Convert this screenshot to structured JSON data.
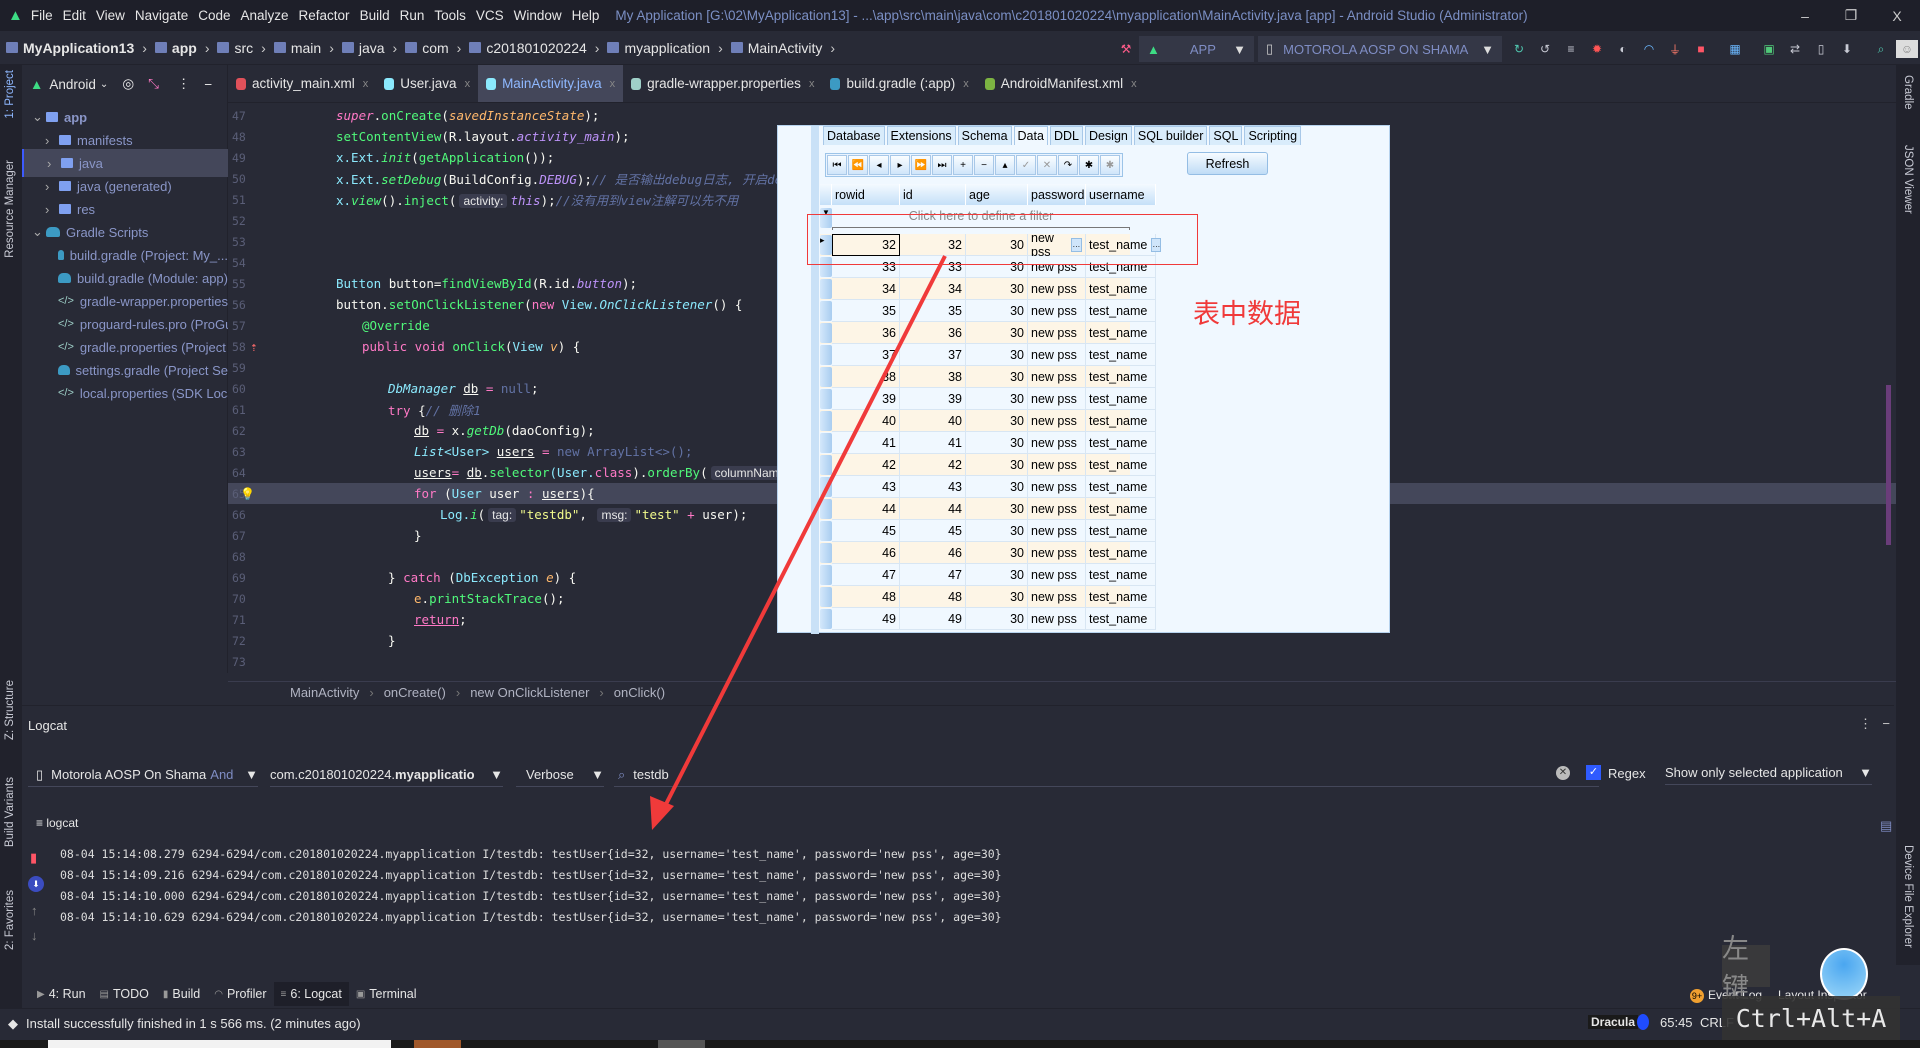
{
  "window": {
    "title": "My Application [G:\\02\\MyApplication13] - ...\\app\\src\\main\\java\\com\\c201801020224\\myapplication\\MainActivity.java [app] - Android Studio (Administrator)",
    "minimize": "–",
    "maximize": "❐",
    "close": "X"
  },
  "menu": [
    "File",
    "Edit",
    "View",
    "Navigate",
    "Code",
    "Analyze",
    "Refactor",
    "Build",
    "Run",
    "Tools",
    "VCS",
    "Window",
    "Help"
  ],
  "breadcrumb": [
    "MyApplication13",
    "app",
    "src",
    "main",
    "java",
    "com",
    "c201801020224",
    "myapplication",
    "MainActivity"
  ],
  "run_config": {
    "module": "APP",
    "device": "MOTOROLA AOSP ON SHAMA"
  },
  "left_strip": {
    "project": "1: Project",
    "resource_manager": "Resource Manager",
    "structure": "Z: Structure",
    "build_variants": "Build Variants",
    "favorites": "2: Favorites"
  },
  "right_strip": {
    "gradle": "Gradle",
    "json_viewer": "JSON Viewer",
    "device_file_explorer": "Device File Explorer"
  },
  "project": {
    "view": "Android",
    "tree": [
      {
        "label": "app",
        "depth": 0,
        "icon": "folder"
      },
      {
        "label": "manifests",
        "depth": 1,
        "icon": "folder"
      },
      {
        "label": "java",
        "depth": 1,
        "icon": "folder",
        "selected": true
      },
      {
        "label": "java (generated)",
        "depth": 1,
        "icon": "folder"
      },
      {
        "label": "res",
        "depth": 1,
        "icon": "folder"
      },
      {
        "label": "Gradle Scripts",
        "depth": 0,
        "icon": "gradle"
      },
      {
        "label": "build.gradle (Project: My_...",
        "depth": 2,
        "icon": "gradle"
      },
      {
        "label": "build.gradle (Module: app)",
        "depth": 2,
        "icon": "gradle"
      },
      {
        "label": "gradle-wrapper.properties",
        "depth": 2,
        "icon": "properties"
      },
      {
        "label": "proguard-rules.pro (ProGuard",
        "depth": 2,
        "icon": "proguard"
      },
      {
        "label": "gradle.properties (Project",
        "depth": 2,
        "icon": "properties"
      },
      {
        "label": "settings.gradle (Project Se",
        "depth": 2,
        "icon": "gradle"
      },
      {
        "label": "local.properties (SDK Loca",
        "depth": 2,
        "icon": "properties"
      }
    ]
  },
  "tabs": [
    {
      "label": "activity_main.xml",
      "color": "#e0515a"
    },
    {
      "label": "User.java",
      "color": "#8be9fd"
    },
    {
      "label": "MainActivity.java",
      "color": "#8be9fd",
      "active": true
    },
    {
      "label": "gradle-wrapper.properties",
      "color": "#9fd0c8"
    },
    {
      "label": "build.gradle (:app)",
      "color": "#3c9ac3"
    },
    {
      "label": "AndroidManifest.xml",
      "color": "#7cb342"
    }
  ],
  "code": [
    {
      "n": "47",
      "ind": 0,
      "t": [
        [
          "super",
          "k i"
        ],
        [
          ".",
          "pl"
        ],
        [
          "onCreate",
          "f"
        ],
        [
          "(",
          "pl"
        ],
        [
          "savedInstanceState",
          "o i"
        ],
        [
          ");",
          "pl"
        ]
      ]
    },
    {
      "n": "48",
      "ind": 0,
      "t": [
        [
          "setContentView",
          "f"
        ],
        [
          "(R.layout.",
          "pl"
        ],
        [
          "activity_main",
          "p i"
        ],
        [
          ");",
          "pl"
        ]
      ]
    },
    {
      "n": "49",
      "ind": 0,
      "t": [
        [
          "x.Ext.",
          "t"
        ],
        [
          "init",
          "f i"
        ],
        [
          "(",
          "pl"
        ],
        [
          "getApplication",
          "f"
        ],
        [
          "());",
          "pl"
        ]
      ]
    },
    {
      "n": "50",
      "ind": 0,
      "t": [
        [
          "x.Ext.",
          "t"
        ],
        [
          "setDebug",
          "f i"
        ],
        [
          "(BuildConfig.",
          "pl"
        ],
        [
          "DEBUG",
          "p i"
        ],
        [
          ");",
          "pl"
        ],
        [
          "// 是否输出debug日志, 开启debug",
          "c"
        ]
      ]
    },
    {
      "n": "51",
      "ind": 0,
      "t": [
        [
          "x.",
          "t"
        ],
        [
          "view",
          "f i"
        ],
        [
          "().",
          "pl"
        ],
        [
          "inject",
          "f"
        ],
        [
          "(",
          "pl"
        ],
        [
          "activity:",
          "hint"
        ],
        [
          "this",
          "p i"
        ],
        [
          ");",
          "pl"
        ],
        [
          "//没有用到view注解可以先不用",
          "c"
        ]
      ]
    },
    {
      "n": "52",
      "ind": 0,
      "t": []
    },
    {
      "n": "53",
      "ind": 0,
      "t": []
    },
    {
      "n": "54",
      "ind": 0,
      "t": []
    },
    {
      "n": "55",
      "ind": 0,
      "t": [
        [
          "Button ",
          "t"
        ],
        [
          "button=",
          "pl"
        ],
        [
          "findViewById",
          "f"
        ],
        [
          "(R.id.",
          "pl"
        ],
        [
          "button",
          "p i"
        ],
        [
          ");",
          "pl"
        ]
      ]
    },
    {
      "n": "56",
      "ind": 0,
      "t": [
        [
          "button.",
          "pl"
        ],
        [
          "setOnClickListener",
          "f"
        ],
        [
          "(",
          "pl"
        ],
        [
          "new ",
          "k"
        ],
        [
          "View.",
          "t"
        ],
        [
          "OnClickListener",
          "t i"
        ],
        [
          "() {",
          "pl"
        ]
      ]
    },
    {
      "n": "57",
      "ind": 1,
      "t": [
        [
          "@Override",
          "f"
        ]
      ]
    },
    {
      "n": "58",
      "ind": 1,
      "t": [
        [
          "public void ",
          "k"
        ],
        [
          "onClick",
          "f"
        ],
        [
          "(",
          "pl"
        ],
        [
          "View ",
          "t"
        ],
        [
          "v",
          "o i"
        ],
        [
          ") {",
          "pl"
        ]
      ]
    },
    {
      "n": "59",
      "ind": 0,
      "t": []
    },
    {
      "n": "60",
      "ind": 2,
      "t": [
        [
          "DbManager ",
          "t i"
        ],
        [
          "db",
          "pl u"
        ],
        [
          " = ",
          "k"
        ],
        [
          "null",
          "g"
        ],
        [
          ";",
          "pl"
        ]
      ]
    },
    {
      "n": "61",
      "ind": 2,
      "t": [
        [
          "try ",
          "k"
        ],
        [
          "{",
          "pl"
        ],
        [
          "// 删除1",
          "c"
        ]
      ]
    },
    {
      "n": "62",
      "ind": 3,
      "t": [
        [
          "db",
          "pl u"
        ],
        [
          " = ",
          "k"
        ],
        [
          "x.",
          "pl"
        ],
        [
          "getDb",
          "f i"
        ],
        [
          "(daoConfig);",
          "pl"
        ]
      ]
    },
    {
      "n": "63",
      "ind": 3,
      "t": [
        [
          "List",
          "t i"
        ],
        [
          "<User> ",
          "t"
        ],
        [
          "users",
          "pl u"
        ],
        [
          " = ",
          "k"
        ],
        [
          "new ArrayList<>();",
          "g"
        ]
      ]
    },
    {
      "n": "64",
      "ind": 3,
      "t": [
        [
          "users",
          "pl u"
        ],
        [
          "= ",
          "k"
        ],
        [
          "db",
          "pl u"
        ],
        [
          ".",
          "pl"
        ],
        [
          "selector",
          "f"
        ],
        [
          "(User.",
          "t"
        ],
        [
          "class",
          "k"
        ],
        [
          ").",
          "pl"
        ],
        [
          "orderBy",
          "f"
        ],
        [
          "(",
          "pl"
        ],
        [
          "columnName",
          "hint"
        ]
      ]
    },
    {
      "n": "65",
      "ind": 3,
      "cur": true,
      "t": [
        [
          "for ",
          "k"
        ],
        [
          "(",
          "pl"
        ],
        [
          "User ",
          "t"
        ],
        [
          "user ",
          "pl"
        ],
        [
          ": ",
          "k"
        ],
        [
          "users",
          "pl u"
        ],
        [
          "){",
          "pl"
        ]
      ]
    },
    {
      "n": "66",
      "ind": 4,
      "t": [
        [
          "Log.",
          "t"
        ],
        [
          "i",
          "f i"
        ],
        [
          "(",
          "pl"
        ],
        [
          "tag:",
          "hint"
        ],
        [
          "\"testdb\"",
          "s"
        ],
        [
          ", ",
          "pl"
        ],
        [
          "msg:",
          "hint"
        ],
        [
          "\"test\"",
          "s"
        ],
        [
          " + ",
          "k"
        ],
        [
          "user);",
          "pl"
        ]
      ]
    },
    {
      "n": "67",
      "ind": 3,
      "t": [
        [
          "}",
          "pl"
        ]
      ]
    },
    {
      "n": "68",
      "ind": 0,
      "t": []
    },
    {
      "n": "69",
      "ind": 2,
      "t": [
        [
          "} ",
          "pl"
        ],
        [
          "catch ",
          "k"
        ],
        [
          "(",
          "pl"
        ],
        [
          "DbException ",
          "t"
        ],
        [
          "e",
          "o i"
        ],
        [
          ") {",
          "pl"
        ]
      ]
    },
    {
      "n": "70",
      "ind": 3,
      "t": [
        [
          "e",
          "o"
        ],
        [
          ".",
          "pl"
        ],
        [
          "printStackTrace",
          "f"
        ],
        [
          "();",
          "pl"
        ]
      ]
    },
    {
      "n": "71",
      "ind": 3,
      "t": [
        [
          "return",
          "k u"
        ],
        [
          ";",
          "pl"
        ]
      ]
    },
    {
      "n": "72",
      "ind": 2,
      "t": [
        [
          "}",
          "pl"
        ]
      ]
    },
    {
      "n": "73",
      "ind": 0,
      "t": []
    }
  ],
  "editor_breadcrumb": [
    "MainActivity",
    "onCreate()",
    "new OnClickListener",
    "onClick()"
  ],
  "db_tool": {
    "tabs": [
      "Database",
      "Extensions",
      "Schema",
      "Data",
      "DDL",
      "Design",
      "SQL builder",
      "SQL",
      "Scripting"
    ],
    "active_tab": "Data",
    "nav_buttons": [
      "first",
      "prior-page",
      "prior",
      "next",
      "next-page",
      "last",
      "insert",
      "delete",
      "edit",
      "post",
      "cancel",
      "refresh-row",
      "bookmark",
      "clear-bookmark"
    ],
    "nav_glyphs": [
      "⏮",
      "⏪",
      "◂",
      "▸",
      "⏩",
      "⏭",
      "+",
      "−",
      "▴",
      "✓",
      "✕",
      "↷",
      "✱",
      "✱"
    ],
    "refresh": "Refresh",
    "filter_hint": "Click here to define a filter",
    "columns": [
      "rowid",
      "id",
      "age",
      "password",
      "username"
    ],
    "rows": [
      [
        32,
        32,
        30,
        "new pss",
        "test_name"
      ],
      [
        33,
        33,
        30,
        "new pss",
        "test_name"
      ],
      [
        34,
        34,
        30,
        "new pss",
        "test_name"
      ],
      [
        35,
        35,
        30,
        "new pss",
        "test_name"
      ],
      [
        36,
        36,
        30,
        "new pss",
        "test_name"
      ],
      [
        37,
        37,
        30,
        "new pss",
        "test_name"
      ],
      [
        38,
        38,
        30,
        "new pss",
        "test_name"
      ],
      [
        39,
        39,
        30,
        "new pss",
        "test_name"
      ],
      [
        40,
        40,
        30,
        "new pss",
        "test_name"
      ],
      [
        41,
        41,
        30,
        "new pss",
        "test_name"
      ],
      [
        42,
        42,
        30,
        "new pss",
        "test_name"
      ],
      [
        43,
        43,
        30,
        "new pss",
        "test_name"
      ],
      [
        44,
        44,
        30,
        "new pss",
        "test_name"
      ],
      [
        45,
        45,
        30,
        "new pss",
        "test_name"
      ],
      [
        46,
        46,
        30,
        "new pss",
        "test_name"
      ],
      [
        47,
        47,
        30,
        "new pss",
        "test_name"
      ],
      [
        48,
        48,
        30,
        "new pss",
        "test_name"
      ],
      [
        49,
        49,
        30,
        "new pss",
        "test_name"
      ]
    ]
  },
  "annotation": {
    "label": "表中数据",
    "color": "#f03a3a"
  },
  "logcat": {
    "title": "Logcat",
    "device": "Motorola AOSP On Shama",
    "device_suffix": "And",
    "package_prefix": "com.c201801020224.",
    "package_bold": "myapplicatio",
    "level": "Verbose",
    "search": "testdb",
    "regex_label": "Regex",
    "regex_checked": true,
    "filter": "Show only selected application",
    "sub_label": "logcat",
    "lines": [
      "08-04 15:14:08.279 6294-6294/com.c201801020224.myapplication I/testdb: testUser{id=32, username='test_name', password='new pss', age=30}",
      "08-04 15:14:09.216 6294-6294/com.c201801020224.myapplication I/testdb: testUser{id=32, username='test_name', password='new pss', age=30}",
      "08-04 15:14:10.000 6294-6294/com.c201801020224.myapplication I/testdb: testUser{id=32, username='test_name', password='new pss', age=30}",
      "08-04 15:14:10.629 6294-6294/com.c201801020224.myapplication I/testdb: testUser{id=32, username='test_name', password='new pss', age=30}"
    ]
  },
  "bottom_tabs": [
    {
      "label": "4: Run"
    },
    {
      "label": "TODO"
    },
    {
      "label": "Build"
    },
    {
      "label": "Profiler"
    },
    {
      "label": "6: Logcat",
      "active": true
    },
    {
      "label": "Terminal"
    }
  ],
  "status": {
    "message": "Install successfully finished in 1 s 566 ms. (2 minutes ago)",
    "event_log": "Event Log",
    "event_badge": "9+",
    "layout_inspector": "Layout Inspector",
    "theme": "Dracula",
    "position": "65:45",
    "line_sep": "CRLF"
  },
  "overlay": {
    "mouse": "左键",
    "keys": "Ctrl+Alt+A"
  }
}
